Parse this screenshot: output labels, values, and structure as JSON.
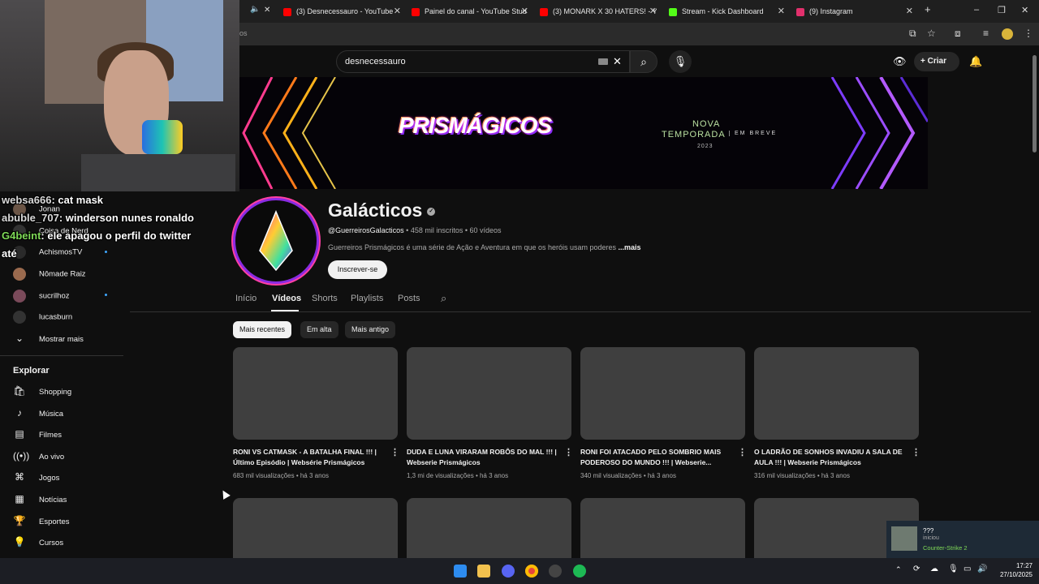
{
  "browser": {
    "tabs": [
      {
        "label": "(3) Desnecessauro - YouTube",
        "color": "#ff0000"
      },
      {
        "label": "Painel do canal - YouTube Stud",
        "color": "#ff0000"
      },
      {
        "label": "(3) MONARK X 30 HATERS! - Yo",
        "color": "#ff0000"
      },
      {
        "label": "Stream - Kick Dashboard",
        "color": "#53fc18"
      },
      {
        "label": "(9) Instagram",
        "color": "#e1306c"
      }
    ],
    "url_partial": "eos"
  },
  "youtube": {
    "search_value": "desnecessauro",
    "create_label": "Criar",
    "banner": {
      "logo_text": "PRISMÁGICOS",
      "nova": "NOVA",
      "temporada": "TEMPORADA",
      "year": "2023",
      "em_breve": "EM BREVE"
    },
    "channel": {
      "name": "Galácticos",
      "handle": "@GuerreirosGalacticos",
      "subscribers": "458 mil inscritos",
      "videos_count": "60 vídeos",
      "description": "Guerreiros Prismágicos é uma série de Ação e Aventura em que os heróis usam poderes",
      "more": "...mais",
      "subscribe_label": "Inscrever-se"
    },
    "tabs": [
      "Início",
      "Vídeos",
      "Shorts",
      "Playlists",
      "Posts"
    ],
    "chips": [
      "Mais recentes",
      "Em alta",
      "Mais antigo"
    ],
    "videos": [
      {
        "title": "RONI VS CATMASK - A BATALHA FINAL !!! | Último Episódio | Websérie Prismágicos",
        "views": "683 mil visualizações",
        "age": "há 3 anos"
      },
      {
        "title": "DUDA E LUNA VIRARAM ROBÔS DO MAL !!! | Webserie Prismágicos",
        "views": "1,3 mi de visualizações",
        "age": "há 3 anos"
      },
      {
        "title": "RONI FOI ATACADO PELO SOMBRIO MAIS PODEROSO DO MUNDO !!! | Webserie...",
        "views": "340 mil visualizações",
        "age": "há 3 anos"
      },
      {
        "title": "O LADRÃO DE SONHOS INVADIU A SALA DE AULA !!! | Webserie Prismágicos",
        "views": "316 mil visualizações",
        "age": "há 3 anos"
      }
    ],
    "sidebar": {
      "subscriptions": [
        {
          "label": "Jonan"
        },
        {
          "label": "Coisa de Nerd"
        },
        {
          "label": "AchismosTV"
        },
        {
          "label": "Nômade Raiz"
        },
        {
          "label": "sucrilhoz"
        },
        {
          "label": "lucasburn"
        }
      ],
      "show_more": "Mostrar mais",
      "explore_title": "Explorar",
      "explore_items": [
        "Shopping",
        "Música",
        "Filmes",
        "Ao vivo",
        "Jogos",
        "Notícias",
        "Esportes",
        "Cursos"
      ]
    }
  },
  "stream_chat": [
    {
      "user": "websa666",
      "message": "cat mask"
    },
    {
      "user": "abuble_707",
      "message": "winderson nunes ronaldo"
    },
    {
      "user": "G4beint",
      "message": "ele apagou o perfil do twitter"
    },
    {
      "user": "",
      "message": "até"
    }
  ],
  "notification": {
    "title": "???",
    "subtitle": "iniciou",
    "game": "Counter-Strike 2"
  },
  "taskbar": {
    "time": "17:27",
    "date": "27/10/2025"
  }
}
